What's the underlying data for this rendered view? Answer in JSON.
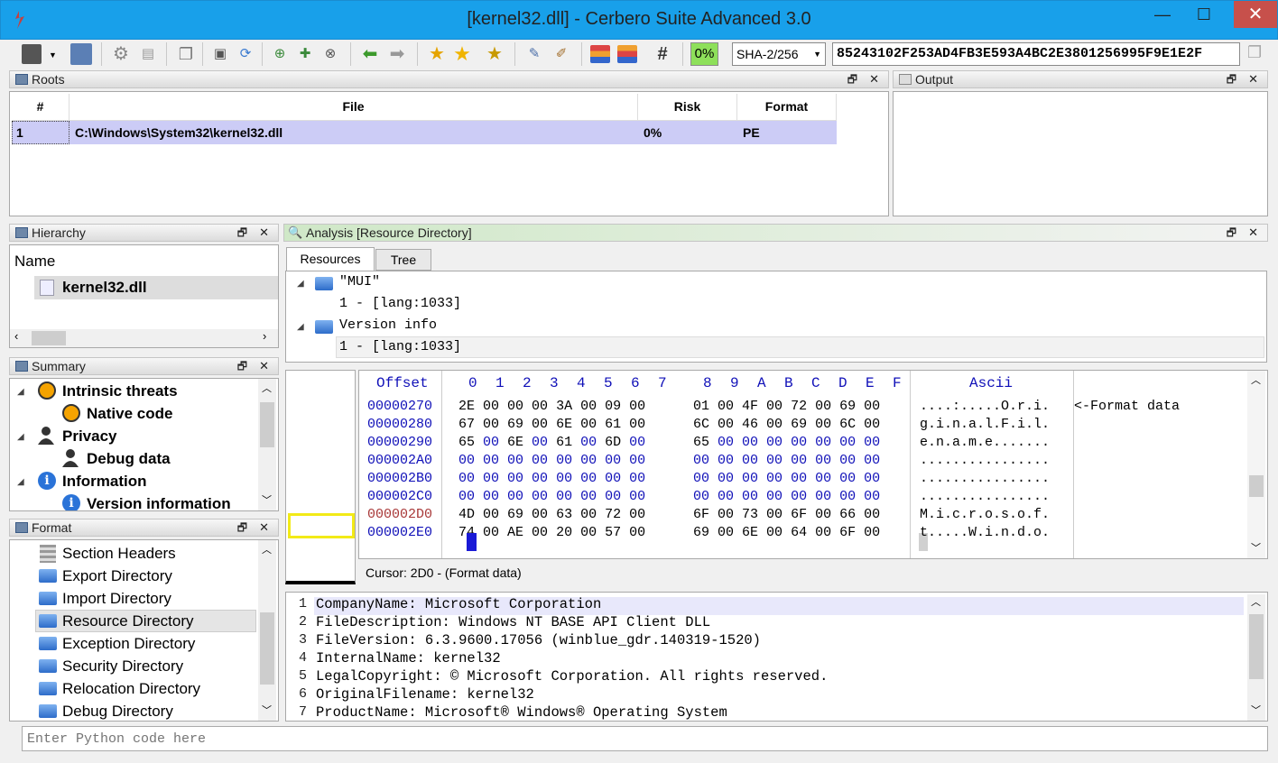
{
  "window": {
    "title": "[kernel32.dll] - Cerbero Suite Advanced 3.0",
    "min": "—",
    "max": "☐",
    "close": "✕"
  },
  "toolbar": {
    "progress": "0%",
    "hash_algo": "SHA-2/256",
    "hash_value": "85243102F253AD4FB3E593A4BC2E3801256995F9E1E2F"
  },
  "roots": {
    "title": "Roots",
    "columns": [
      "#",
      "File",
      "Risk",
      "Format"
    ],
    "rows": [
      {
        "num": "1",
        "file": "C:\\Windows\\System32\\kernel32.dll",
        "risk": "0%",
        "format": "PE"
      }
    ]
  },
  "output": {
    "title": "Output"
  },
  "hierarchy": {
    "title": "Hierarchy",
    "column": "Name",
    "item": "kernel32.dll"
  },
  "summary": {
    "title": "Summary",
    "items": [
      "Intrinsic threats",
      "Native code",
      "Privacy",
      "Debug data",
      "Information",
      "Version information"
    ]
  },
  "format": {
    "title": "Format",
    "items": [
      "Section Headers",
      "Export Directory",
      "Import Directory",
      "Resource Directory",
      "Exception Directory",
      "Security Directory",
      "Relocation Directory",
      "Debug Directory"
    ]
  },
  "analysis": {
    "title": "Analysis [Resource Directory]",
    "tabs": [
      "Resources",
      "Tree"
    ],
    "tree": [
      "\"MUI\"",
      "1 - [lang:1033]",
      "Version info",
      "1 - [lang:1033]"
    ]
  },
  "hex": {
    "offset_label": "Offset",
    "cols": [
      "0",
      "1",
      "2",
      "3",
      "4",
      "5",
      "6",
      "7",
      "8",
      "9",
      "A",
      "B",
      "C",
      "D",
      "E",
      "F"
    ],
    "ascii_label": "Ascii",
    "rows": [
      {
        "off": "00000270",
        "a": "2E 00 00 00 3A 00 09 00",
        "b": "01 00 4F 00 72 00 69 00",
        "ascii": "....:.....O.r.i."
      },
      {
        "off": "00000280",
        "a": "67 00 69 00 6E 00 61 00",
        "b": "6C 00 46 00 69 00 6C 00",
        "ascii": "g.i.n.a.l.F.i.l."
      },
      {
        "off": "00000290",
        "a": "65 00 6E 00 61 00 6D 00",
        "b": "65 00 00 00 00 00 00 00",
        "ascii": "e.n.a.m.e......."
      },
      {
        "off": "000002A0",
        "a": "00 00 00 00 00 00 00 00",
        "b": "00 00 00 00 00 00 00 00",
        "ascii": "................"
      },
      {
        "off": "000002B0",
        "a": "00 00 00 00 00 00 00 00",
        "b": "00 00 00 00 00 00 00 00",
        "ascii": "................"
      },
      {
        "off": "000002C0",
        "a": "00 00 00 00 00 00 00 00",
        "b": "00 00 00 00 00 00 00 00",
        "ascii": "................"
      },
      {
        "off": "000002D0",
        "a": "4D 00 69 00 63 00 72 00",
        "b": "6F 00 73 00 6F 00 66 00",
        "ascii": "M.i.c.r.o.s.o.f."
      },
      {
        "off": "000002E0",
        "a": "74 00 AE 00 20 00 57 00",
        "b": "69 00 6E 00 64 00 6F 00",
        "ascii": "t.....W.i.n.d.o."
      }
    ],
    "annotation": "<-Format data",
    "status": "Cursor: 2D0 - (Format data)"
  },
  "editor": {
    "lines": [
      "CompanyName: Microsoft Corporation",
      "FileDescription: Windows NT BASE API Client DLL",
      "FileVersion: 6.3.9600.17056 (winblue_gdr.140319-1520)",
      "InternalName: kernel32",
      "LegalCopyright: © Microsoft Corporation. All rights reserved.",
      "OriginalFilename: kernel32",
      "ProductName: Microsoft® Windows® Operating System"
    ]
  },
  "python": {
    "placeholder": "Enter Python code here"
  }
}
